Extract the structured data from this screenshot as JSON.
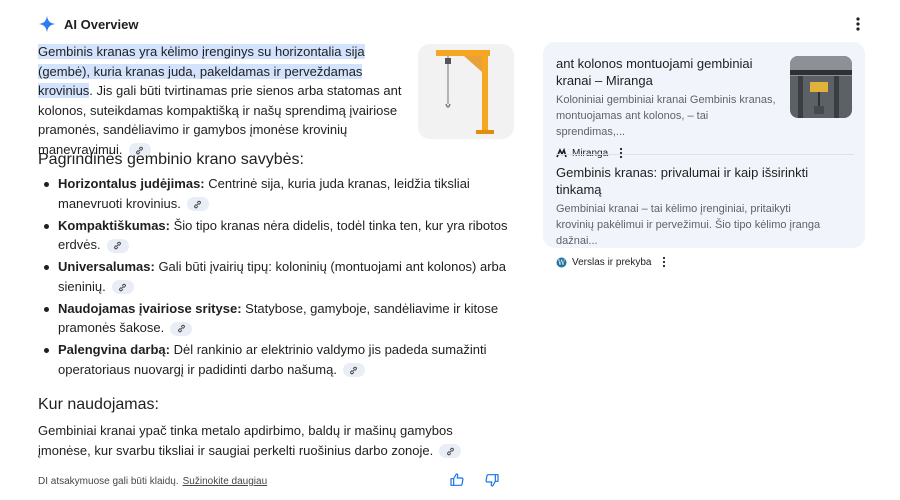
{
  "header": {
    "title": "AI Overview",
    "spark_icon": "sparkle-icon",
    "more_icon": "more-vert-icon"
  },
  "intro": {
    "highlight": "Gembinis kranas yra kėlimo įrenginys su horizontalia sija (gembė), kuria kranas juda, pakeldamas ir perveždamas krovinius",
    "rest": ". Jis gali būti tvirtinamas prie sienos arba statomas ant kolonos, suteikdamas kompaktišką ir našų sprendimą įvairiose pramonės, sandėliavimo ir gamybos įmonėse krovinių manevravimui."
  },
  "section1": {
    "heading": "Pagrindinės gembinio krano savybės:"
  },
  "features": [
    {
      "term": "Horizontalus judėjimas:",
      "text": " Centrinė sija, kuria juda kranas, leidžia tiksliai manevruoti krovinius."
    },
    {
      "term": "Kompaktiškumas:",
      "text": " Šio tipo kranas nėra didelis, todėl tinka ten, kur yra ribotos erdvės."
    },
    {
      "term": "Universalumas:",
      "text": " Gali būti įvairių tipų: koloninių (montuojami ant kolonos) arba sieninių."
    },
    {
      "term": "Naudojamas įvairiose srityse:",
      "text": " Statybose, gamyboje, sandėliavime ir kitose pramonės šakose."
    },
    {
      "term": "Palengvina darbą:",
      "text": " Dėl rankinio ar elektrinio valdymo jis padeda sumažinti operatoriaus nuovargį ir padidinti darbo našumą."
    }
  ],
  "section2": {
    "heading": "Kur naudojamas:"
  },
  "usage": {
    "text": "Gembiniai kranai ypač tinka metalo apdirbimo, baldų ir mašinų gamybos įmonėse, kur svarbu tiksliai ir saugiai perkelti ruošinius darbo zonoje."
  },
  "footer": {
    "disclaimer": "DI atsakymuose gali būti klaidų.",
    "link": "Sužinokite daugiau"
  },
  "sources": [
    {
      "title": "ant kolonos montuojami gembiniai kranai – Miranga",
      "snippet": "Koloniniai gembiniai kranai Gembinis kranas, montuojamas ant kolonos, – tai sprendimas,...",
      "site": "Miranga",
      "icon": "miranga-logo-icon"
    },
    {
      "title": "Gembinis kranas: privalumai ir kaip išsirinkti tinkamą",
      "snippet": "Gembiniai kranai – tai kėlimo įrenginiai, pritaikyti krovinių pakėlimui ir pervežimui. Šio tipo kėlimo įranga dažnai...",
      "site": "Verslas ir prekyba",
      "icon": "wordpress-icon"
    }
  ],
  "colors": {
    "highlight": "#d3e3fd",
    "panel": "#f1f4fb",
    "chip": "#e9eef6",
    "accent": "#1a73e8",
    "crane": "#f5a623"
  }
}
